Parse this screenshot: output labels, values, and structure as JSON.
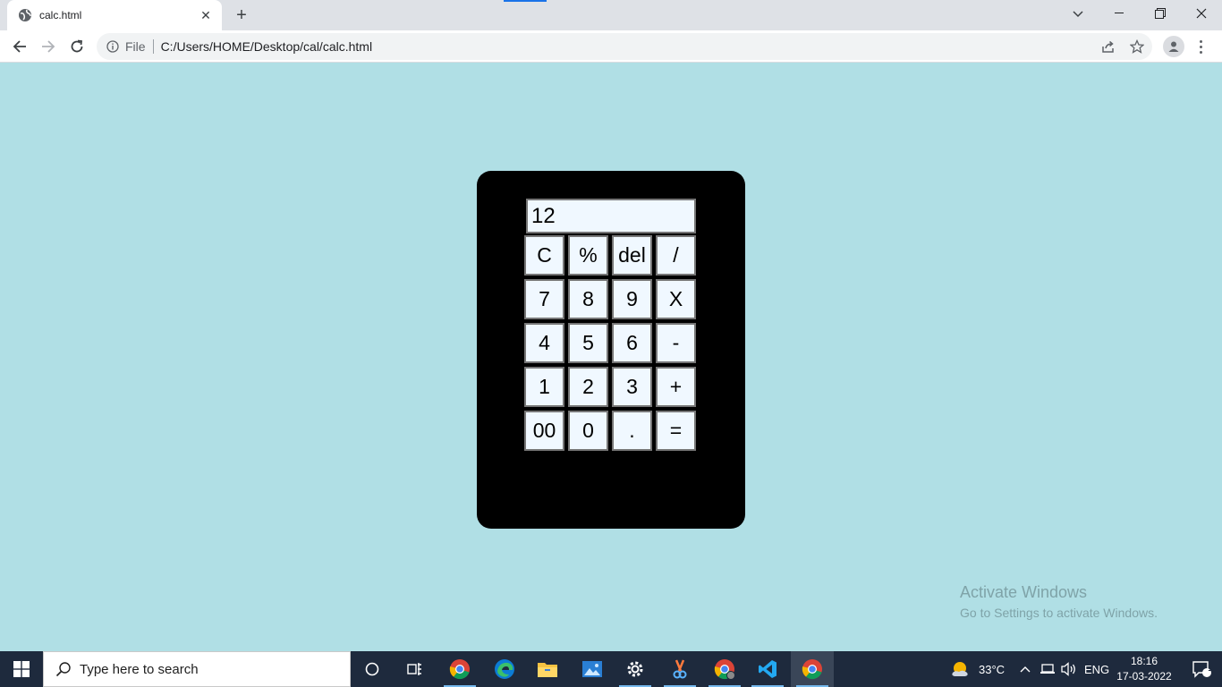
{
  "browser": {
    "tab_title": "calc.html",
    "close_glyph": "✕",
    "newtab_glyph": "+",
    "file_label": "File",
    "url": "C:/Users/HOME/Desktop/cal/calc.html"
  },
  "calculator": {
    "display_value": "12",
    "keys": [
      "C",
      "%",
      "del",
      "/",
      "7",
      "8",
      "9",
      "X",
      "4",
      "5",
      "6",
      "-",
      "1",
      "2",
      "3",
      "+",
      "00",
      "0",
      ".",
      "="
    ]
  },
  "watermark": {
    "line1": "Activate Windows",
    "line2": "Go to Settings to activate Windows."
  },
  "taskbar": {
    "search_placeholder": "Type here to search",
    "temperature": "33°C",
    "language": "ENG",
    "time": "18:16",
    "date": "17-03-2022",
    "notification_count": "1"
  },
  "colors": {
    "page_bg": "#b0dfe5",
    "calc_bg": "#000000",
    "key_bg": "#f0f8ff",
    "taskbar_bg": "#1e2a3d"
  }
}
